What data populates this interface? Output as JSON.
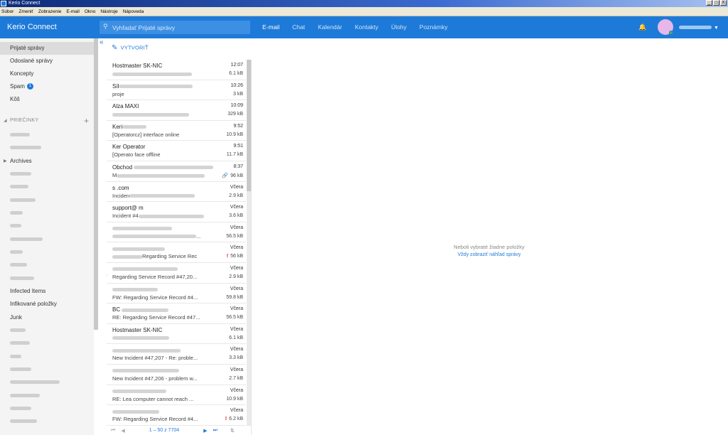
{
  "window": {
    "title": "Kerio Connect",
    "menu": [
      "Súbor",
      "Zmeniť",
      "Zobrazenie",
      "E-mail",
      "Okno",
      "Nástroje",
      "Nápoveda"
    ],
    "controls": [
      "_",
      "□",
      "X"
    ]
  },
  "header": {
    "app_name": "Kerio Connect",
    "search_placeholder": "Vyhľadať Prijaté správy",
    "tabs": [
      "E-mail",
      "Chat",
      "Kalendár",
      "Kontakty",
      "Úlohy",
      "Poznámky"
    ],
    "active_tab": "E-mail",
    "accent": "#1e7ad8"
  },
  "sidebar": {
    "items": [
      {
        "label": "Prijaté správy"
      },
      {
        "label": "Odoslané správy"
      },
      {
        "label": "Koncepty"
      },
      {
        "label": "Spam",
        "badge": "1"
      },
      {
        "label": "Kôš"
      }
    ],
    "folders_header": "PRIEČINKY",
    "add_label": "+",
    "folders": [
      {
        "label": "Archives"
      },
      {
        "label": "Infected Items"
      },
      {
        "label": "Infikované položky"
      },
      {
        "label": "Junk"
      }
    ]
  },
  "list": {
    "compose_label": "VYTVORIŤ",
    "collapse_label": "«",
    "messages": [
      {
        "from": "Hostmaster SK-NIC",
        "time": "12:07",
        "size": "6.1 kB"
      },
      {
        "from": "Síl",
        "subj": "proje",
        "time": "10:26",
        "size": "3 kB"
      },
      {
        "from": "Alza MAXI",
        "time": "10:09",
        "size": "329 kB"
      },
      {
        "from": "Keri",
        "subj": "[Operatorcz] interface online",
        "time": "9:52",
        "size": "10.9 kB"
      },
      {
        "from": "Ker Operator",
        "subj": "[Operato face offline",
        "time": "9:51",
        "size": "11.7 kB"
      },
      {
        "from": "Obchod",
        "subj": "M",
        "time": "8:37",
        "size": "96 kB",
        "clip": true
      },
      {
        "from": "s .com",
        "subj": "Inciden",
        "time": "Včera",
        "size": "2.9 kB"
      },
      {
        "from": "support@ m",
        "subj": "Incident #4",
        "time": "Včera",
        "size": "3.6 kB"
      },
      {
        "from": "",
        "subj": "",
        "subj_tail": "...",
        "time": "Včera",
        "size": "56.5 kB"
      },
      {
        "from": "",
        "subj": "Regarding Service Rec",
        "time": "Včera",
        "size": "56 kB",
        "flag": true
      },
      {
        "from": "",
        "subj": "Regarding Service Record #47,20...",
        "time": "Včera",
        "size": "2.9 kB",
        "reply": true
      },
      {
        "from": "",
        "subj": "FW: Regarding Service Record #4...",
        "time": "Včera",
        "size": "59.8 kB"
      },
      {
        "from": "BC",
        "subj": "RE: Regarding Service Record #47...",
        "time": "Včera",
        "size": "56.5 kB"
      },
      {
        "from": "Hostmaster SK-NIC",
        "time": "Včera",
        "size": "6.1 kB"
      },
      {
        "from": "",
        "subj": "New Incident #47,207 - Re: proble...",
        "time": "Včera",
        "size": "3.3 kB"
      },
      {
        "from": "",
        "subj": "New Incident #47,206 - problem w...",
        "time": "Včera",
        "size": "2.7 kB"
      },
      {
        "from": "",
        "subj": "RE: Lea computer cannot reach ...",
        "time": "Včera",
        "size": "10.9 kB"
      },
      {
        "from": "",
        "subj": "FW: Regarding Service Record #4...",
        "time": "Včera",
        "size": "6.2 kB",
        "flag": true
      }
    ],
    "pager": {
      "range": "1 – 50 z 7704",
      "first": "⏮",
      "prev": "◀",
      "next": "▶",
      "last": "⏭",
      "sort": "⇅"
    }
  },
  "reading": {
    "empty_text": "Neboli vybraté žiadne položky",
    "preview_link": "Vždy zobraziť náhľad správy"
  }
}
